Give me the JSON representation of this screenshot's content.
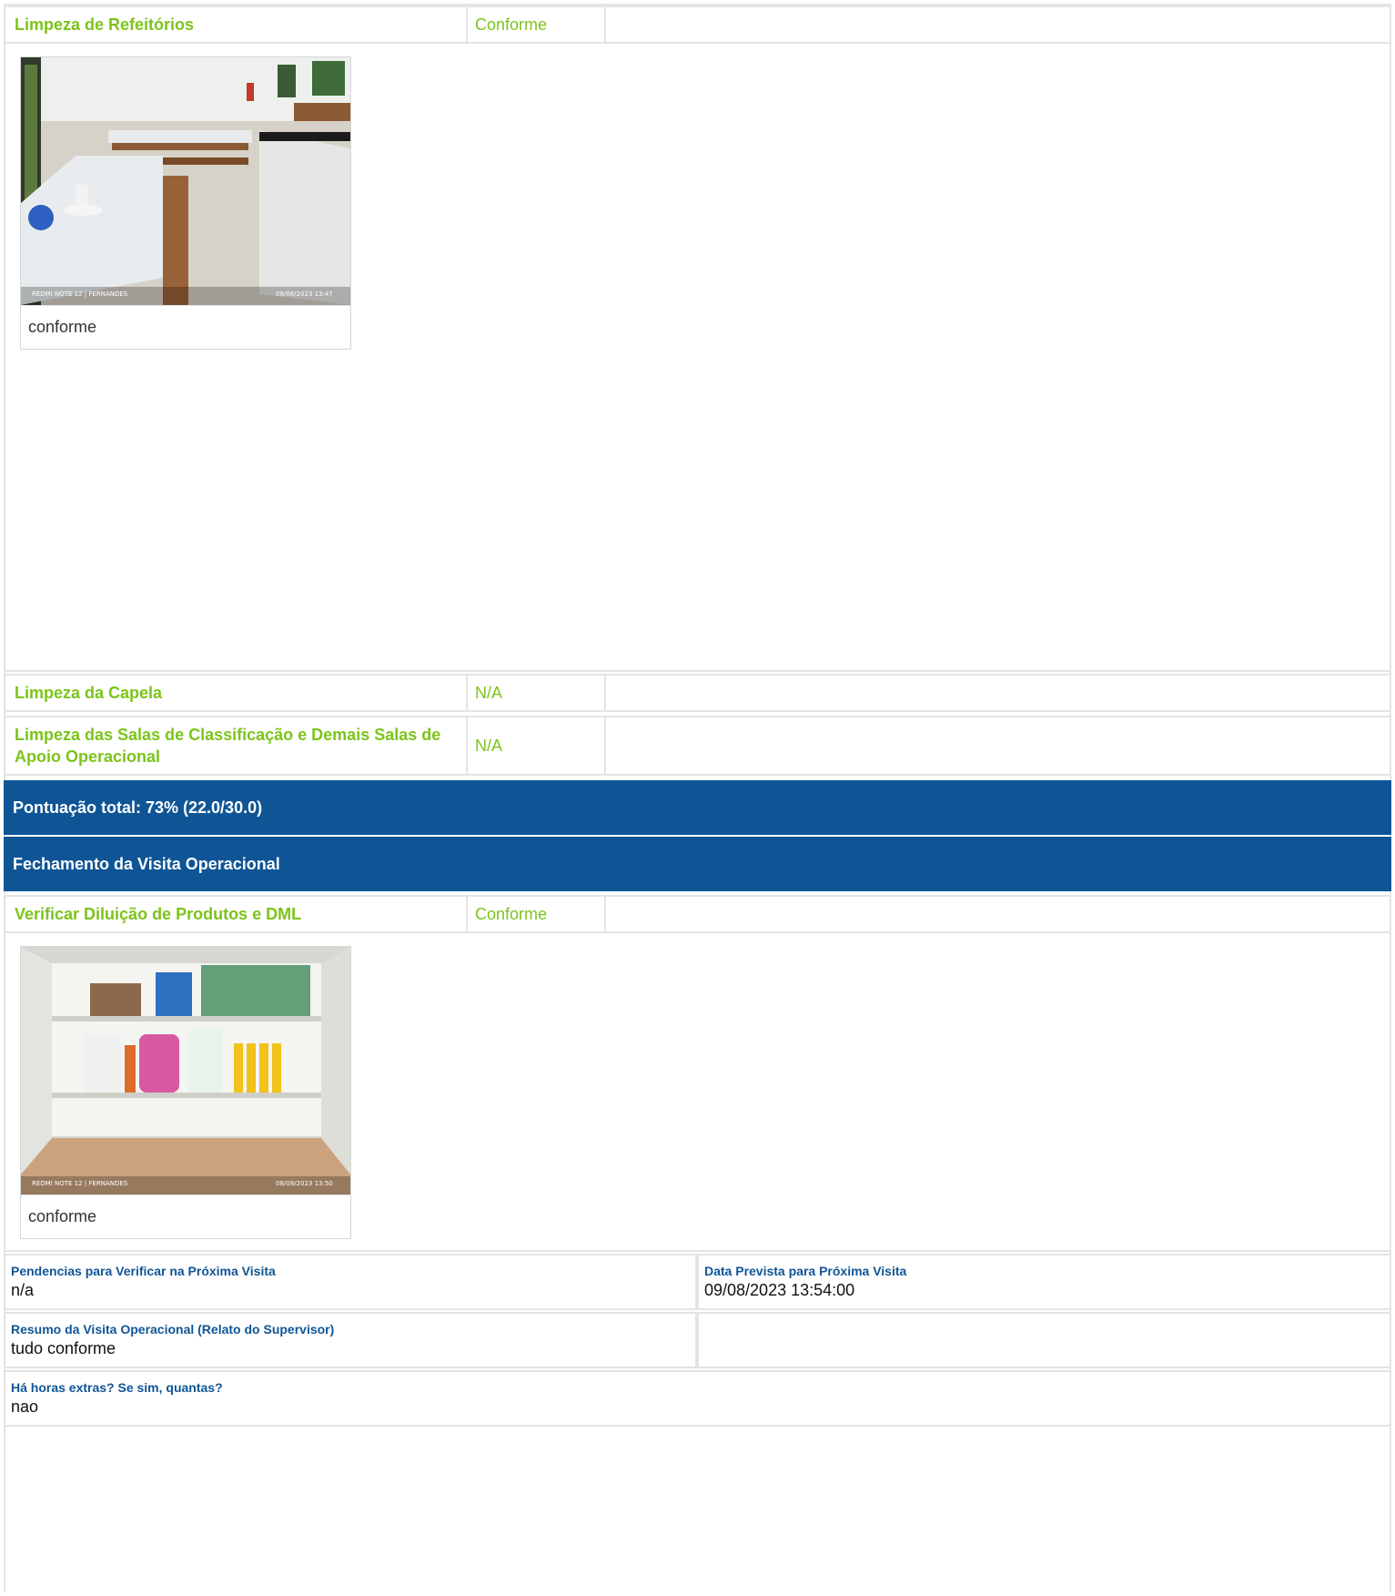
{
  "items": [
    {
      "title": "Limpeza de Refeitórios",
      "status": "Conforme",
      "photo_caption": "conforme"
    },
    {
      "title": "Limpeza da Capela",
      "status": "N/A"
    },
    {
      "title": "Limpeza das Salas de Classificação e Demais Salas de Apoio Operacional",
      "status": "N/A"
    }
  ],
  "score_bar": "Pontuação total: 73% (22.0/30.0)",
  "section_bar": "Fechamento da Visita Operacional",
  "closing_item": {
    "title": "Verificar Diluição de Produtos e DML",
    "status": "Conforme",
    "photo_caption": "conforme"
  },
  "photo_stamps": {
    "photo1_left": "REDMI NOTE 12 | FERNANDES",
    "photo1_right": "08/08/2023  13:47",
    "photo2_left": "REDMI NOTE 12 | FERNANDES",
    "photo2_right": "08/08/2023  13:50"
  },
  "fields": {
    "pendencias": {
      "label": "Pendencias para Verificar na Próxima Visita",
      "value": "n/a"
    },
    "data_prevista": {
      "label": "Data Prevista para Próxima Visita",
      "value": "09/08/2023 13:54:00"
    },
    "resumo": {
      "label": "Resumo da Visita Operacional (Relato do Supervisor)",
      "value": "tudo conforme"
    },
    "horas_extras": {
      "label": "Há horas extras? Se sim, quantas?",
      "value": "nao"
    }
  },
  "colors": {
    "accent_green": "#7cc41a",
    "header_blue": "#0f5596",
    "border": "#e4e4e4"
  }
}
